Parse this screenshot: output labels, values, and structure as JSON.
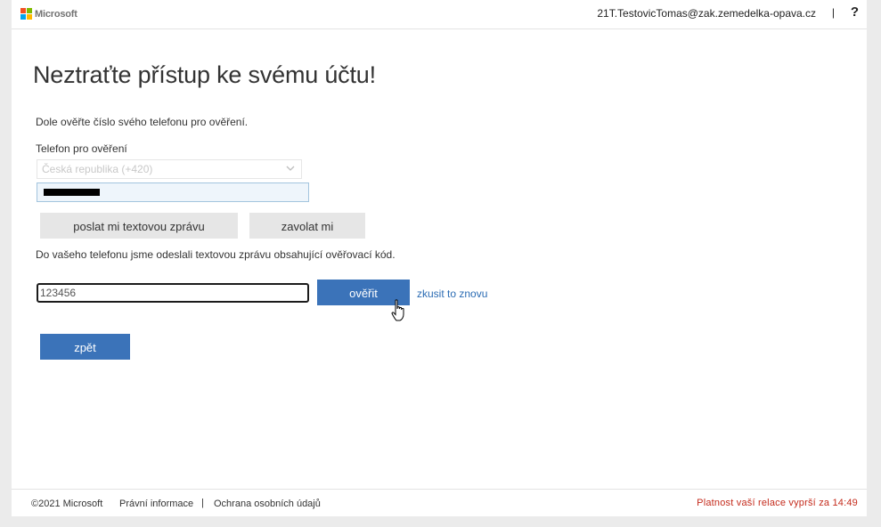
{
  "header": {
    "brand": "Microsoft",
    "user_email": "21T.TestovicTomas@zak.zemedelka-opava.cz",
    "separator": "|",
    "help": "?"
  },
  "main": {
    "title": "Neztraťte přístup ke svému účtu!",
    "description": "Dole ověřte číslo svého telefonu pro ověření.",
    "phone_label": "Telefon pro ověření",
    "country_select": "Česká republika (+420)",
    "sms_button": "poslat mi textovou zprávu",
    "call_button": "zavolat mi",
    "sent_message": "Do vašeho telefonu jsme odeslali textovou zprávu obsahující ověřovací kód.",
    "code_value": "123456",
    "verify_button": "ověřit",
    "retry_link": "zkusit to znovu",
    "back_button": "zpět"
  },
  "footer": {
    "copyright": "©2021 Microsoft",
    "legal": "Právní informace",
    "separator": "|",
    "privacy": "Ochrana osobních údajů",
    "session_notice": "Platnost vaší relace vyprší za 14:49"
  },
  "colors": {
    "accent": "#3b73b9",
    "link": "#2a6bb3",
    "session_warning": "#c42b1c",
    "ms_red": "#f25022",
    "ms_green": "#7fba00",
    "ms_blue": "#00a4ef",
    "ms_yellow": "#ffb900"
  },
  "icons": [
    "microsoft-logo-icon",
    "chevron-down-icon",
    "hand-cursor-icon"
  ]
}
